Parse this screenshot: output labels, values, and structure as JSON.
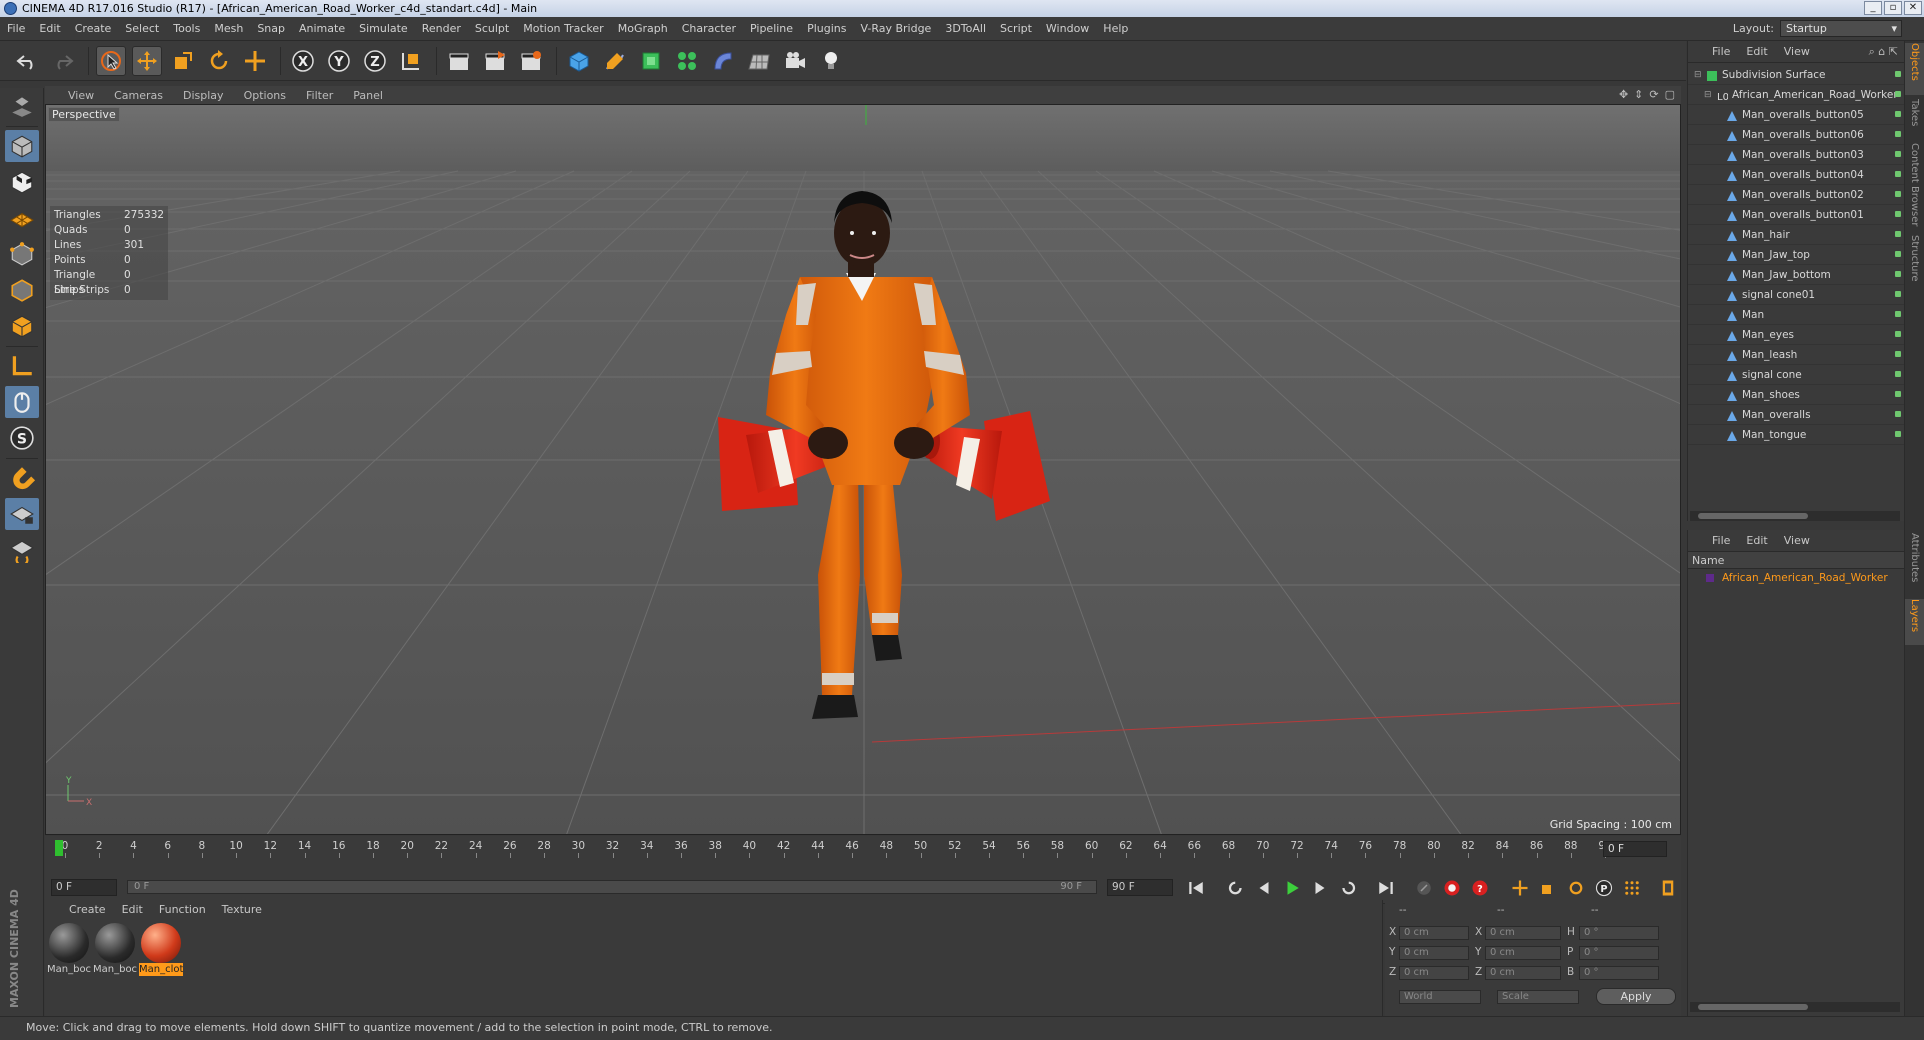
{
  "window": {
    "title": "CINEMA 4D R17.016 Studio (R17) - [African_American_Road_Worker_c4d_standart.c4d] - Main"
  },
  "menubar": {
    "items": [
      "File",
      "Edit",
      "Create",
      "Select",
      "Tools",
      "Mesh",
      "Snap",
      "Animate",
      "Simulate",
      "Render",
      "Sculpt",
      "Motion Tracker",
      "MoGraph",
      "Character",
      "Pipeline",
      "Plugins",
      "V-Ray Bridge",
      "3DToAll",
      "Script",
      "Window",
      "Help"
    ],
    "layout_label": "Layout:",
    "layout_value": "Startup"
  },
  "viewport": {
    "menu": [
      "View",
      "Cameras",
      "Display",
      "Options",
      "Filter",
      "Panel"
    ],
    "camera_label": "Perspective",
    "stats": [
      {
        "k": "Triangles",
        "v": "275332"
      },
      {
        "k": "Quads",
        "v": "0"
      },
      {
        "k": "Lines",
        "v": "301"
      },
      {
        "k": "Points",
        "v": "0"
      },
      {
        "k": "Triangle Strips",
        "v": "0"
      },
      {
        "k": "Line Strips",
        "v": "0"
      }
    ],
    "grid_spacing": "Grid Spacing : 100 cm"
  },
  "timeline": {
    "frames": [
      "0",
      "2",
      "4",
      "6",
      "8",
      "10",
      "12",
      "14",
      "16",
      "18",
      "20",
      "22",
      "24",
      "26",
      "28",
      "30",
      "32",
      "34",
      "36",
      "38",
      "40",
      "42",
      "44",
      "46",
      "48",
      "50",
      "52",
      "54",
      "56",
      "58",
      "60",
      "62",
      "64",
      "66",
      "68",
      "70",
      "72",
      "74",
      "76",
      "78",
      "80",
      "82",
      "84",
      "86",
      "88",
      "90"
    ],
    "current_frame": "0 F"
  },
  "transport": {
    "start_field": "0 F",
    "range_start": "0 F",
    "range_end": "90 F",
    "end_field": "90 F"
  },
  "material_manager": {
    "menu": [
      "Create",
      "Edit",
      "Function",
      "Texture"
    ],
    "materials": [
      {
        "label": "Man_boc",
        "color": "#3a3a3a"
      },
      {
        "label": "Man_boc",
        "color": "#3a3a3a"
      },
      {
        "label": "Man_clot",
        "color": "#d03a1a"
      }
    ]
  },
  "coordinates": {
    "headers": [
      "--",
      "--",
      "--"
    ],
    "rows": [
      {
        "a": "X",
        "av": "0 cm",
        "b": "X",
        "bv": "0 cm",
        "c": "H",
        "cv": "0 °"
      },
      {
        "a": "Y",
        "av": "0 cm",
        "b": "Y",
        "bv": "0 cm",
        "c": "P",
        "cv": "0 °"
      },
      {
        "a": "Z",
        "av": "0 cm",
        "b": "Z",
        "bv": "0 cm",
        "c": "B",
        "cv": "0 °"
      }
    ],
    "mode1": "World",
    "mode2": "Scale",
    "apply": "Apply"
  },
  "status_bar": "Move: Click and drag to move elements. Hold down SHIFT to quantize movement / add to the selection in point mode, CTRL to remove.",
  "brand": "MAXON CINEMA 4D",
  "object_manager": {
    "menu": [
      "File",
      "Edit",
      "View"
    ],
    "objects": [
      {
        "name": "Subdivision Surface",
        "level": 0,
        "icon": "subdivision-icon"
      },
      {
        "name": "African_American_Road_Worker",
        "level": 1,
        "icon": "null-object-icon"
      },
      {
        "name": "Man_overalls_button05",
        "level": 2,
        "icon": "polygon-object-icon"
      },
      {
        "name": "Man_overalls_button06",
        "level": 2,
        "icon": "polygon-object-icon"
      },
      {
        "name": "Man_overalls_button03",
        "level": 2,
        "icon": "polygon-object-icon"
      },
      {
        "name": "Man_overalls_button04",
        "level": 2,
        "icon": "polygon-object-icon"
      },
      {
        "name": "Man_overalls_button02",
        "level": 2,
        "icon": "polygon-object-icon"
      },
      {
        "name": "Man_overalls_button01",
        "level": 2,
        "icon": "polygon-object-icon"
      },
      {
        "name": "Man_hair",
        "level": 2,
        "icon": "polygon-object-icon"
      },
      {
        "name": "Man_Jaw_top",
        "level": 2,
        "icon": "polygon-object-icon"
      },
      {
        "name": "Man_Jaw_bottom",
        "level": 2,
        "icon": "polygon-object-icon"
      },
      {
        "name": "signal cone01",
        "level": 2,
        "icon": "polygon-object-icon"
      },
      {
        "name": "Man",
        "level": 2,
        "icon": "polygon-object-icon"
      },
      {
        "name": "Man_eyes",
        "level": 2,
        "icon": "polygon-object-icon"
      },
      {
        "name": "Man_leash",
        "level": 2,
        "icon": "polygon-object-icon"
      },
      {
        "name": "signal cone",
        "level": 2,
        "icon": "polygon-object-icon"
      },
      {
        "name": "Man_shoes",
        "level": 2,
        "icon": "polygon-object-icon"
      },
      {
        "name": "Man_overalls",
        "level": 2,
        "icon": "polygon-object-icon"
      },
      {
        "name": "Man_tongue",
        "level": 2,
        "icon": "polygon-object-icon"
      }
    ]
  },
  "layer_manager": {
    "menu": [
      "File",
      "Edit",
      "View"
    ],
    "name_header": "Name",
    "layers": [
      "African_American_Road_Worker"
    ]
  },
  "right_tabs": [
    "Objects",
    "Takes",
    "Content Browser",
    "Structure",
    "Attributes",
    "Layers"
  ],
  "colors": {
    "accent": "#ff9a1a",
    "selection": "#5b7fa6",
    "overalls": "#e86a10",
    "cone": "#e8281a"
  }
}
